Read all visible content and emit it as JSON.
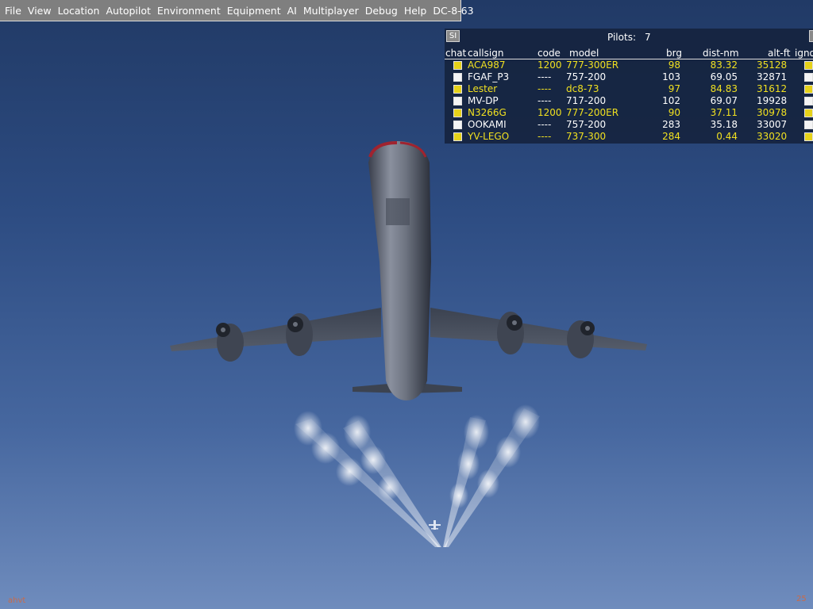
{
  "menu": [
    "File",
    "View",
    "Location",
    "Autopilot",
    "Environment",
    "Equipment",
    "AI",
    "Multiplayer",
    "Debug",
    "Help",
    "DC-8-63"
  ],
  "pilot_list": {
    "si_label": "SI",
    "pilots_label": "Pilots:",
    "pilots_count": "7",
    "headers": {
      "chat": "chat",
      "callsign": "callsign",
      "code": "code",
      "model": "model",
      "brg": "brg",
      "dist": "dist-nm",
      "alt": "alt-ft",
      "ignore": "ignore"
    },
    "rows": [
      {
        "callsign": "ACA987",
        "code": "1200",
        "model": "777-300ER",
        "brg": "98",
        "dist": "83.32",
        "alt": "35128",
        "highlight": true
      },
      {
        "callsign": "FGAF_P3",
        "code": "----",
        "model": "757-200",
        "brg": "103",
        "dist": "69.05",
        "alt": "32871",
        "highlight": false
      },
      {
        "callsign": "Lester",
        "code": "----",
        "model": "dc8-73",
        "brg": "97",
        "dist": "84.83",
        "alt": "31612",
        "highlight": true
      },
      {
        "callsign": "MV-DP",
        "code": "----",
        "model": "717-200",
        "brg": "102",
        "dist": "69.07",
        "alt": "19928",
        "highlight": false
      },
      {
        "callsign": "N3266G",
        "code": "1200",
        "model": "777-200ER",
        "brg": "90",
        "dist": "37.11",
        "alt": "30978",
        "highlight": true
      },
      {
        "callsign": "OOKAMI",
        "code": "----",
        "model": "757-200",
        "brg": "283",
        "dist": "35.18",
        "alt": "33007",
        "highlight": false
      },
      {
        "callsign": "YV-LEGO",
        "code": "----",
        "model": "737-300",
        "brg": "284",
        "dist": "0.44",
        "alt": "33020",
        "highlight": true
      }
    ]
  },
  "colors": {
    "highlight_text": "#f0e020",
    "highlight_box": "#e6d21a",
    "normal_text": "#ffffff",
    "normal_box": "#f4f4f4"
  },
  "status": {
    "left": "ahvt",
    "right": "25"
  }
}
